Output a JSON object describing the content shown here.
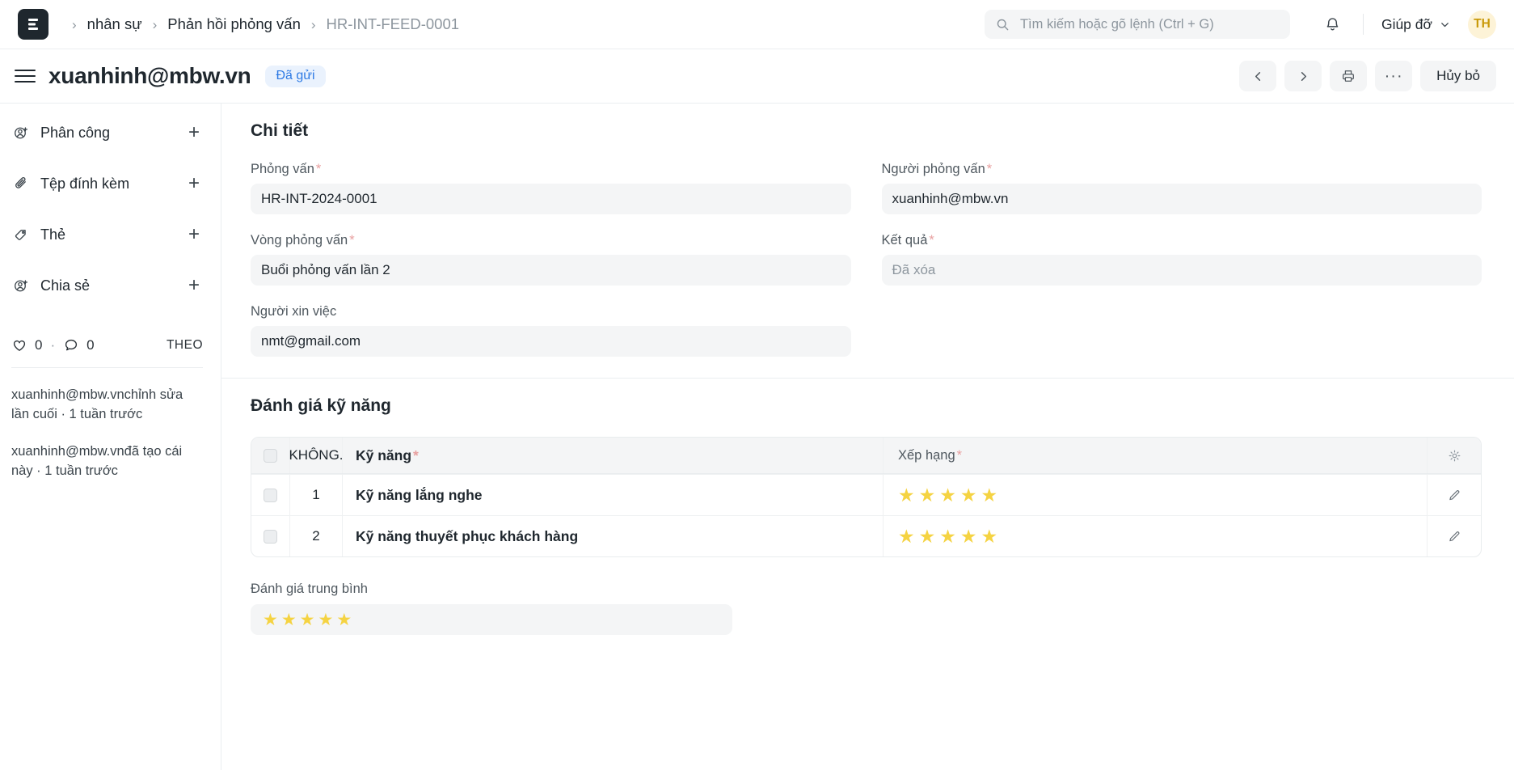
{
  "navbar": {
    "logo_letter": "E",
    "breadcrumb": [
      {
        "label": "nhân sự",
        "current": false
      },
      {
        "label": "Phản hồi phỏng vấn",
        "current": false
      },
      {
        "label": "HR-INT-FEED-0001",
        "current": true
      }
    ],
    "breadcrumb_separator": "›",
    "search_placeholder": "Tìm kiếm hoặc gõ lệnh (Ctrl + G)",
    "search_value": "",
    "search_icon": "search-icon",
    "bell_icon": "bell-icon",
    "help_label": "Giúp đỡ",
    "help_chevron": "chevron-down-icon",
    "avatar_initials": "TH",
    "avatar_bg": "#fdf3d7",
    "avatar_color": "#c99a0b"
  },
  "page_header": {
    "menu_icon": "hamburger-icon",
    "title": "xuanhinh@mbw.vn",
    "status": "Đã gửi",
    "status_bg": "#eaf2fd",
    "status_color": "#2d7ae4",
    "prev_icon": "chevron-left-icon",
    "next_icon": "chevron-right-icon",
    "print_icon": "printer-icon",
    "more_label": "···",
    "cancel_label": "Hủy bỏ"
  },
  "sidebar": {
    "items": [
      {
        "label": "Phân công",
        "icon": "user-plus-icon",
        "add": "+"
      },
      {
        "label": "Tệp đính kèm",
        "icon": "paperclip-icon",
        "add": "+"
      },
      {
        "label": "Thẻ",
        "icon": "tag-icon",
        "add": "+"
      },
      {
        "label": "Chia sẻ",
        "icon": "user-share-icon",
        "add": "+"
      }
    ],
    "stats": {
      "like_icon": "heart-icon",
      "like_count": "0",
      "separator": "·",
      "comment_icon": "comment-icon",
      "comment_count": "0",
      "follow_label": "THEO"
    },
    "activity": [
      {
        "user": "xuanhinh@mbw.vn",
        "text": "chỉnh sửa lần cuối · 1 tuần trước"
      },
      {
        "user": "xuanhinh@mbw.vn",
        "text": "đã tạo cái này · 1 tuần trước"
      }
    ]
  },
  "details": {
    "section_title": "Chi tiết",
    "fields": [
      {
        "label": "Phỏng vấn",
        "required": true,
        "value": "HR-INT-2024-0001",
        "placeholder": false
      },
      {
        "label": "Người phỏng vấn",
        "required": true,
        "value": "xuanhinh@mbw.vn",
        "placeholder": false
      },
      {
        "label": "Vòng phỏng vấn",
        "required": true,
        "value": "Buổi phỏng vấn lần 2",
        "placeholder": false
      },
      {
        "label": "Kết quả",
        "required": true,
        "value": "Đã xóa",
        "placeholder": true
      },
      {
        "label": "Người xin việc",
        "required": false,
        "value": "nmt@gmail.com",
        "placeholder": false
      }
    ]
  },
  "skill_section": {
    "section_title": "Đánh giá kỹ năng",
    "table": {
      "settings_icon": "gear-icon",
      "columns": [
        {
          "key": "no",
          "label": "KHÔNG.",
          "required": false
        },
        {
          "key": "skill",
          "label": "Kỹ năng",
          "required": true
        },
        {
          "key": "rank",
          "label": "Xếp hạng",
          "required": true
        }
      ],
      "rows": [
        {
          "no": "1",
          "skill": "Kỹ năng lắng nghe",
          "stars": 5,
          "edit_icon": "pencil-icon"
        },
        {
          "no": "2",
          "skill": "Kỹ năng thuyết phục khách hàng",
          "stars": 5,
          "edit_icon": "pencil-icon"
        }
      ]
    },
    "average": {
      "label": "Đánh giá trung bình",
      "stars": 5
    },
    "star_color": "#f5d342",
    "star_glyph": "★"
  }
}
